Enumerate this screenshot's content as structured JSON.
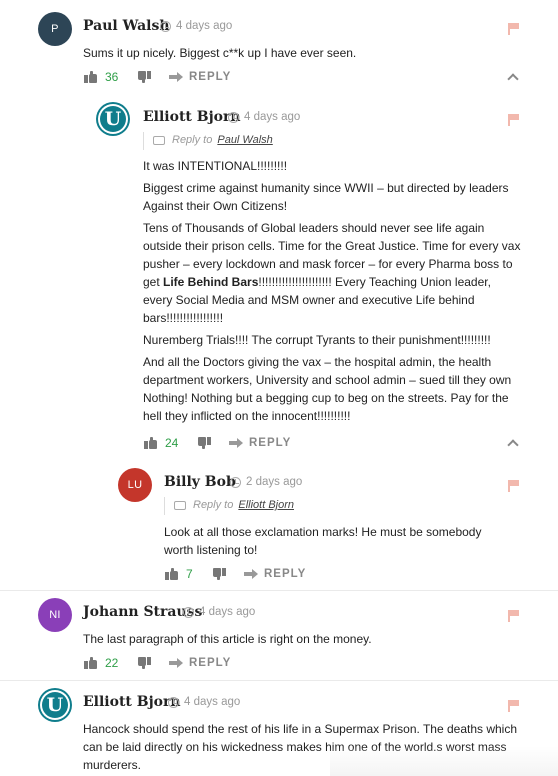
{
  "comments": [
    {
      "author": "Paul Walsh",
      "avatar_initials": "P",
      "avatar_color": "#2d4556",
      "time": "4 days ago",
      "paragraphs": [
        "Sums it up nicely. Biggest c**k up I have ever seen."
      ],
      "votes": "36",
      "reply_label": "REPLY"
    },
    {
      "author": "Elliott Bjorn",
      "avatar_initials": "U",
      "avatar_color": "#0f7d8c",
      "time": "4 days ago",
      "reply_prefix": "Reply to",
      "reply_to": "Paul Walsh",
      "paragraphs": [
        "It was INTENTIONAL!!!!!!!!!",
        "Biggest crime against humanity since WWII – but directed by leaders Against their Own Citizens!",
        "Tens of Thousands of Global leaders should never see life again outside their prison cells. Time for the Great Justice. Time for every vax pusher – every lockdown and mask forcer – for every Pharma boss to get ",
        "Life Behind Bars",
        "!!!!!!!!!!!!!!!!!!!!!! Every Teaching Union leader, every Social Media and MSM owner and executive Life behind bars!!!!!!!!!!!!!!!!!",
        "Nuremberg Trials!!!! The corrupt Tyrants to their punishment!!!!!!!!!",
        "And all the Doctors giving the vax – the hospital admin, the health department workers, University and school admin – sued till they own Nothing! Nothing but a begging cup to beg on the streets. Pay for the hell they inflicted on the innocent!!!!!!!!!!"
      ],
      "votes": "24",
      "reply_label": "REPLY"
    },
    {
      "author": "Billy Bob",
      "avatar_initials": "LU",
      "avatar_color": "#c4362b",
      "time": "2 days ago",
      "reply_prefix": "Reply to",
      "reply_to": "Elliott Bjorn",
      "paragraphs": [
        "Look at all those exclamation marks! He must be somebody worth listening to!"
      ],
      "votes": "7",
      "reply_label": "REPLY"
    },
    {
      "author": "Johann Strauss",
      "avatar_initials": "NI",
      "avatar_color": "#8a3fb8",
      "time": "4 days ago",
      "paragraphs": [
        "The last paragraph of this article is right on the money."
      ],
      "votes": "22",
      "reply_label": "REPLY"
    },
    {
      "author": "Elliott Bjorn",
      "avatar_initials": "U",
      "avatar_color": "#0f7d8c",
      "time": "4 days ago",
      "paragraphs": [
        "Hancock should spend the rest of his life in a Supermax Prison. The deaths which can be laid directly on his wickedness makes him one of the world.s worst mass murderers."
      ]
    }
  ]
}
